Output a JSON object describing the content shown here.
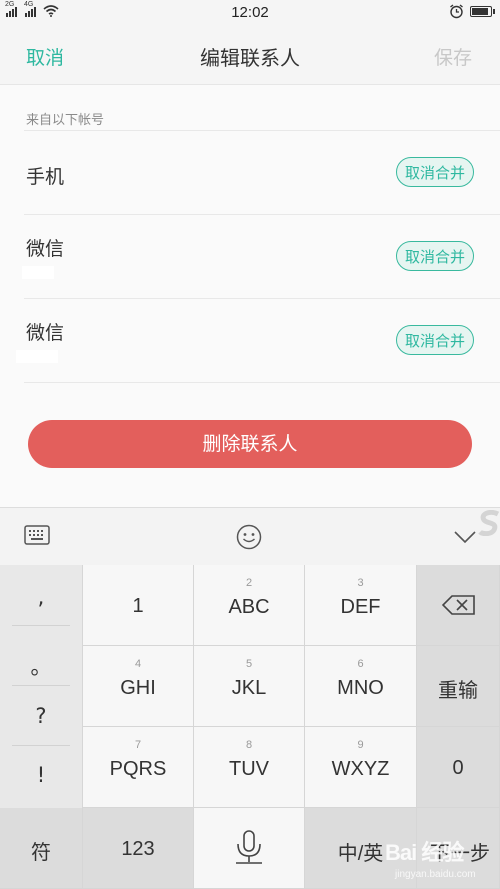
{
  "status": {
    "net1": "2G",
    "net2": "4G",
    "time": "12:02"
  },
  "header": {
    "cancel_label": "取消",
    "title": "编辑联系人",
    "save_label": "保存"
  },
  "accounts": {
    "section_label": "来自以下帐号",
    "items": [
      {
        "name": "手机",
        "action_label": "取消合并"
      },
      {
        "name": "微信",
        "action_label": "取消合并"
      },
      {
        "name": "微信",
        "action_label": "取消合并"
      }
    ]
  },
  "delete_label": "删除联系人",
  "keyboard": {
    "toolbar_icons": [
      "keyboard-icon",
      "emoji-icon",
      "collapse-chevron-icon"
    ],
    "punctuation": [
      ",",
      "。",
      "?",
      "!"
    ],
    "keys": {
      "k1": {
        "main": "1"
      },
      "k2": {
        "num": "2",
        "main": "ABC"
      },
      "k3": {
        "num": "3",
        "main": "DEF"
      },
      "k4": {
        "num": "4",
        "main": "GHI"
      },
      "k5": {
        "num": "5",
        "main": "JKL"
      },
      "k6": {
        "num": "6",
        "main": "MNO"
      },
      "k7": {
        "num": "7",
        "main": "PQRS"
      },
      "k8": {
        "num": "8",
        "main": "TUV"
      },
      "k9": {
        "num": "9",
        "main": "WXYZ"
      },
      "backspace": "backspace-icon",
      "retype": "重输",
      "zero": "0",
      "symbol": "符",
      "num123": "123",
      "mic": "microphone-icon",
      "lang": "中/英",
      "next": "下一步"
    }
  },
  "watermark": {
    "brand": "Bai 经验",
    "url": "jingyan.baidu.com"
  }
}
